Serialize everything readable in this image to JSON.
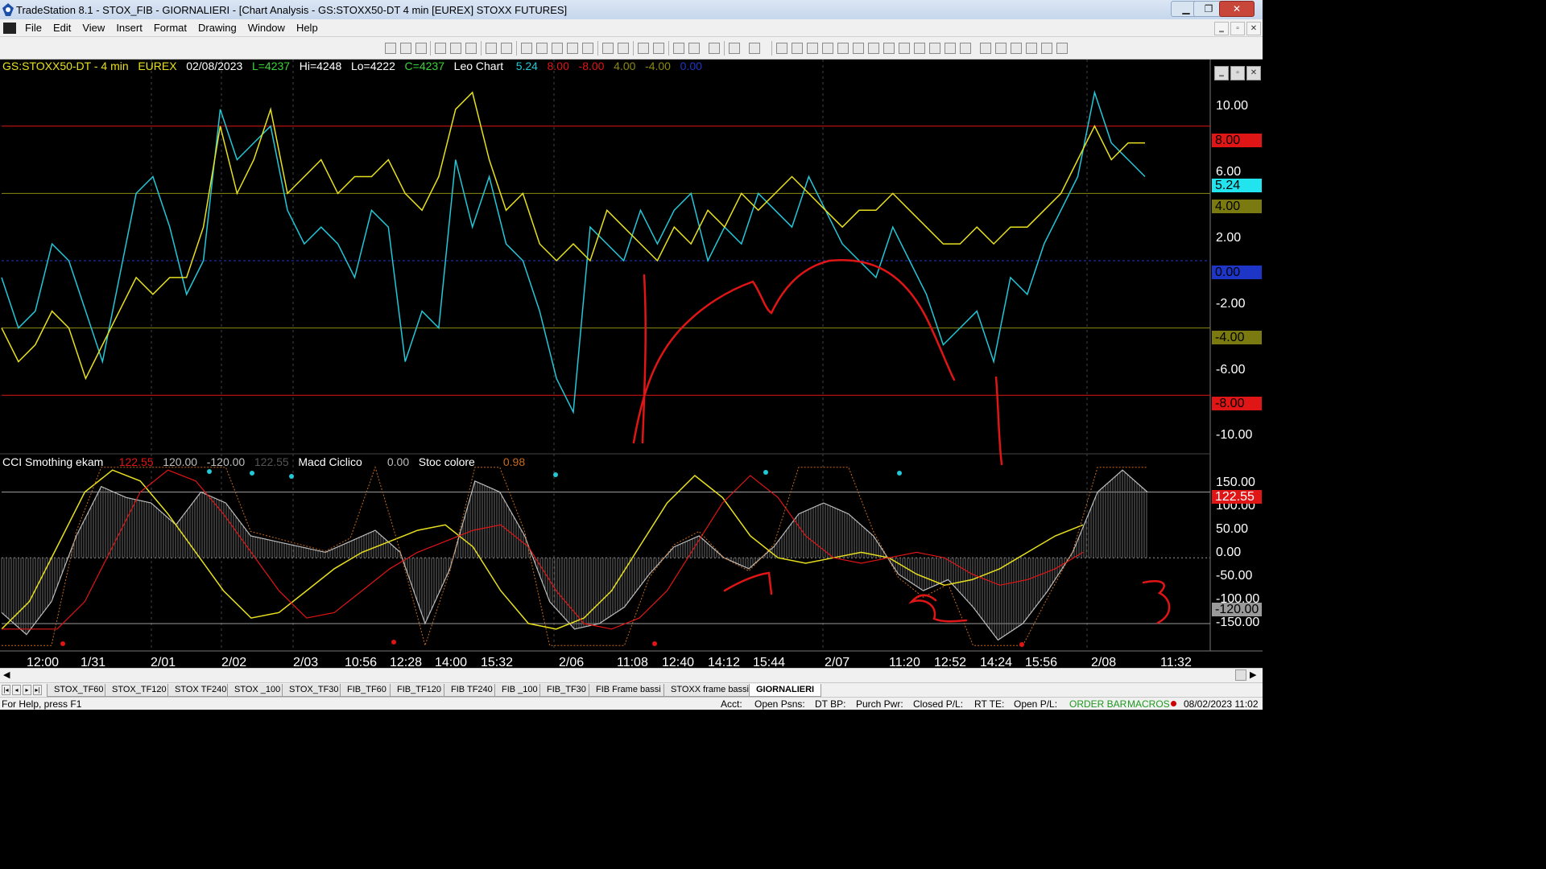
{
  "window": {
    "title": "TradeStation 8.1 - STOX_FIB - GIORNALIERI - [Chart Analysis - GS:STOXX50-DT  4 min  [EUREX] STOXX FUTURES]",
    "minimize": "▁",
    "maximize": "❐",
    "close": "✕"
  },
  "menu": {
    "items": [
      "File",
      "Edit",
      "View",
      "Insert",
      "Format",
      "Drawing",
      "Window",
      "Help"
    ],
    "mdi": [
      "‗",
      "▫",
      "✕"
    ]
  },
  "header": {
    "symbol": "GS:STOXX50-DT - 4 min",
    "exchange": "EUREX",
    "date": "02/08/2023",
    "last": "L=4237",
    "high": "Hi=4248",
    "low": "Lo=4222",
    "close": "C=4237",
    "study": "Leo Chart",
    "values": [
      "5.24",
      "8.00",
      "-8.00",
      "4.00",
      "-4.00",
      "0.00"
    ]
  },
  "subheader": {
    "cci_name": "CCI Smothing ekam",
    "cci_values": [
      "122.55",
      "120.00",
      "-120.00",
      "122.55"
    ],
    "macd_name": "Macd Ciclico",
    "macd_value": "0.00",
    "stoc_name": "Stoc colore",
    "stoc_value": "0.98"
  },
  "axes": {
    "top_ticks": [
      "10.00",
      "6.00",
      "2.00",
      "-2.00",
      "-6.00",
      "-10.00"
    ],
    "top_boxes": [
      "8.00",
      "5.24",
      "4.00",
      "0.00",
      "-4.00",
      "-8.00"
    ],
    "bottom_ticks": [
      "150.00",
      "100.00",
      "50.00",
      "0.00",
      "-50.00",
      "-100.00",
      "-150.00"
    ],
    "bottom_boxes": [
      "122.55",
      "-120.00"
    ],
    "x_labels": [
      "12:00",
      "1/31",
      "2/01",
      "2/02",
      "2/03",
      "10:56",
      "12:28",
      "14:00",
      "15:32",
      "2/06",
      "11:08",
      "12:40",
      "14:12",
      "15:44",
      "2/07",
      "11:20",
      "12:52",
      "14:24",
      "15:56",
      "2/08",
      "11:32"
    ]
  },
  "colors": {
    "cyan": "#22c7d8",
    "yellow": "#e8e01e",
    "red": "#e01515",
    "olive": "#8a8a10",
    "blue": "#1e36c8",
    "orange": "#c86a1a",
    "grey": "#bdbdbd"
  },
  "sheets": [
    "STOX_TF60",
    "STOX_TF120",
    "STOX TF240",
    "STOX _100",
    "STOX_TF30",
    "FIB_TF60",
    "FIB_TF120",
    "FIB TF240",
    "FIB _100",
    "FIB_TF30",
    "FIB Frame bassi",
    "STOXX frame bassi",
    "GIORNALIERI"
  ],
  "status": {
    "help": "For Help, press F1",
    "acct": "Acct:",
    "open_psns": "Open Psns:",
    "dt_bp": "DT BP:",
    "purch_pwr": "Purch Pwr:",
    "closed_pl": "Closed P/L:",
    "rt_te": "RT TE:",
    "open_pl": "Open P/L:",
    "order_bar": "ORDER BAR",
    "macros": "MACROS",
    "datetime": "08/02/2023 11:02"
  },
  "chart_data": {
    "type": "line",
    "top_pane": {
      "ylim": [
        -11,
        11
      ],
      "series": [
        {
          "values": [
            -1,
            -4,
            -3,
            1,
            0,
            -3,
            -6,
            -1,
            4,
            5,
            2,
            -2,
            0,
            9,
            6,
            7,
            8,
            3,
            1,
            2,
            1,
            -1,
            3,
            2,
            -6,
            -3,
            -4,
            6,
            2,
            5,
            1,
            0,
            -3,
            -7,
            -9,
            2,
            1,
            0,
            3,
            1,
            3,
            4,
            0,
            2,
            1,
            4,
            3,
            2,
            5,
            3,
            1,
            0,
            -1,
            2,
            0,
            -2,
            -5,
            -4,
            -3,
            -6,
            -1,
            -2,
            1,
            3,
            5,
            10,
            7,
            6,
            5
          ]
        },
        {
          "values": [
            -4,
            -6,
            -5,
            -3,
            -4,
            -7,
            -5,
            -3,
            -1,
            -2,
            -1,
            -1,
            2,
            8,
            4,
            6,
            9,
            4,
            5,
            6,
            4,
            5,
            5,
            6,
            4,
            3,
            5,
            9,
            10,
            6,
            3,
            4,
            1,
            0,
            1,
            0,
            3,
            2,
            1,
            0,
            2,
            1,
            3,
            2,
            4,
            3,
            4,
            5,
            4,
            3,
            2,
            3,
            3,
            4,
            3,
            2,
            1,
            1,
            2,
            1,
            2,
            2,
            3,
            4,
            6,
            8,
            6,
            7,
            7
          ]
        }
      ],
      "levels": [
        8,
        4,
        0,
        -4,
        -8
      ]
    },
    "bottom_pane": {
      "ylim": [
        -170,
        175
      ],
      "series": [
        {
          "values": [
            -100,
            -140,
            -80,
            40,
            130,
            110,
            100,
            60,
            120,
            100,
            40,
            30,
            20,
            10,
            30,
            50,
            10,
            -120,
            -20,
            140,
            120,
            40,
            -80,
            -130,
            -120,
            -90,
            -30,
            20,
            40,
            0,
            -20,
            20,
            80,
            100,
            80,
            40,
            -30,
            -60,
            -40,
            -90,
            -150,
            -120,
            -60,
            10,
            120,
            160,
            120
          ]
        },
        {
          "values": [
            -130,
            -80,
            20,
            120,
            160,
            140,
            80,
            10,
            -60,
            -110,
            -100,
            -60,
            -20,
            10,
            30,
            50,
            60,
            20,
            -60,
            -120,
            -130,
            -110,
            -60,
            20,
            100,
            150,
            110,
            40,
            0,
            -10,
            0,
            10,
            0,
            -30,
            -50,
            -40,
            -20,
            10,
            40,
            60
          ]
        }
      ],
      "levels": [
        120,
        0,
        -120
      ]
    }
  }
}
